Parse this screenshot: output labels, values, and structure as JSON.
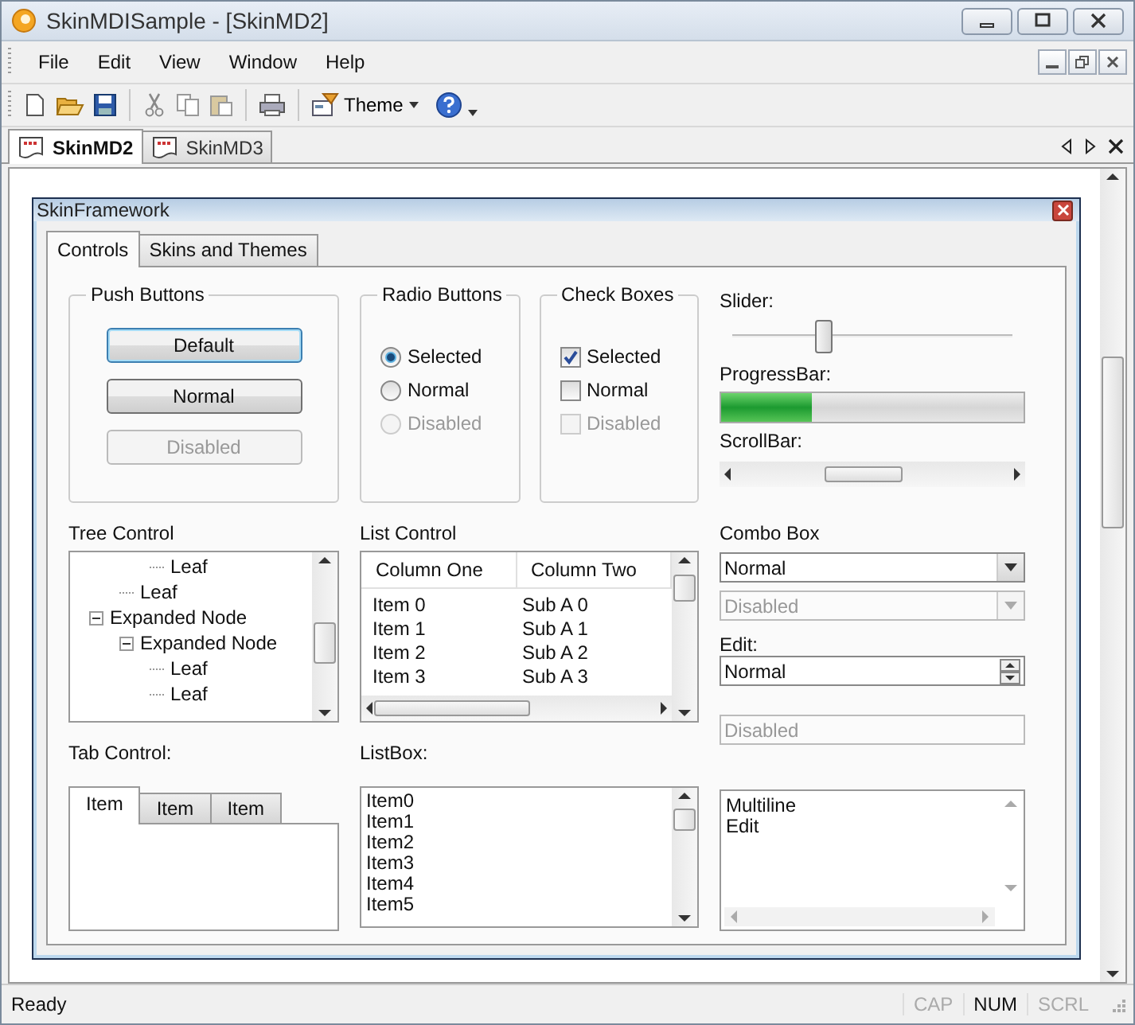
{
  "window": {
    "title": "SkinMDISample - [SkinMD2]"
  },
  "menu": [
    "File",
    "Edit",
    "View",
    "Window",
    "Help"
  ],
  "toolbar": {
    "theme_label": "Theme"
  },
  "document_tabs": [
    {
      "label": "SkinMD2",
      "selected": true
    },
    {
      "label": "SkinMD3",
      "selected": false
    }
  ],
  "child_window": {
    "title": "SkinFramework",
    "tabs": [
      {
        "label": "Controls",
        "selected": true
      },
      {
        "label": "Skins and Themes",
        "selected": false
      }
    ],
    "push_buttons": {
      "title": "Push Buttons",
      "buttons": [
        {
          "label": "Default",
          "kind": "default",
          "disabled": false
        },
        {
          "label": "Normal",
          "kind": "normal",
          "disabled": false
        },
        {
          "label": "Disabled",
          "kind": "normal",
          "disabled": true
        }
      ]
    },
    "radio_buttons": {
      "title": "Radio Buttons",
      "items": [
        {
          "label": "Selected",
          "selected": true,
          "disabled": false
        },
        {
          "label": "Normal",
          "selected": false,
          "disabled": false
        },
        {
          "label": "Disabled",
          "selected": false,
          "disabled": true
        }
      ]
    },
    "check_boxes": {
      "title": "Check Boxes",
      "items": [
        {
          "label": "Selected",
          "checked": true,
          "disabled": false
        },
        {
          "label": "Normal",
          "checked": false,
          "disabled": false
        },
        {
          "label": "Disabled",
          "checked": false,
          "disabled": true
        }
      ]
    },
    "slider": {
      "label": "Slider:",
      "level": 0.32
    },
    "progress_bar": {
      "label": "ProgressBar:",
      "level": 0.3
    },
    "scroll_bar": {
      "label": "ScrollBar:"
    },
    "tree": {
      "label": "Tree Control",
      "items": [
        {
          "children": [
            {
              "children": [
                {
                  "label": "Leaf"
                }
              ]
            },
            {
              "label": "Leaf"
            }
          ]
        },
        {
          "label": "Expanded Node",
          "expanded": true,
          "children": [
            {
              "label": "Expanded Node",
              "expanded": true,
              "children": [
                {
                  "label": "Leaf"
                },
                {
                  "label": "Leaf"
                }
              ]
            }
          ]
        }
      ]
    },
    "list_control": {
      "label": "List Control",
      "columns": [
        "Column One",
        "Column Two"
      ],
      "rows": [
        [
          "Item 0",
          "Sub A 0"
        ],
        [
          "Item 1",
          "Sub A 1"
        ],
        [
          "Item 2",
          "Sub A 2"
        ],
        [
          "Item 3",
          "Sub A 3"
        ]
      ]
    },
    "tab_control": {
      "label": "Tab Control:",
      "tabs": [
        {
          "label": "Item",
          "selected": true
        },
        {
          "label": "Item",
          "selected": false
        },
        {
          "label": "Item",
          "selected": false
        }
      ]
    },
    "list_box": {
      "label": "ListBox:",
      "items": [
        "Item0",
        "Item1",
        "Item2",
        "Item3",
        "Item4",
        "Item5"
      ]
    },
    "combo_box": {
      "label": "Combo Box",
      "fields": [
        {
          "value": "Normal",
          "disabled": false
        },
        {
          "value": "Disabled",
          "disabled": true
        }
      ]
    },
    "edit": {
      "label": "Edit:",
      "fields": [
        {
          "value": "Normal",
          "kind": "spin",
          "disabled": false
        },
        {
          "value": "Disabled",
          "kind": "plain",
          "disabled": true
        }
      ]
    },
    "multiline_edit": {
      "lines": [
        "Multiline",
        "Edit"
      ]
    }
  },
  "status_bar": {
    "text": "Ready",
    "indicators": [
      {
        "label": "CAP",
        "on": false
      },
      {
        "label": "NUM",
        "on": true
      },
      {
        "label": "SCRL",
        "on": false
      }
    ]
  }
}
